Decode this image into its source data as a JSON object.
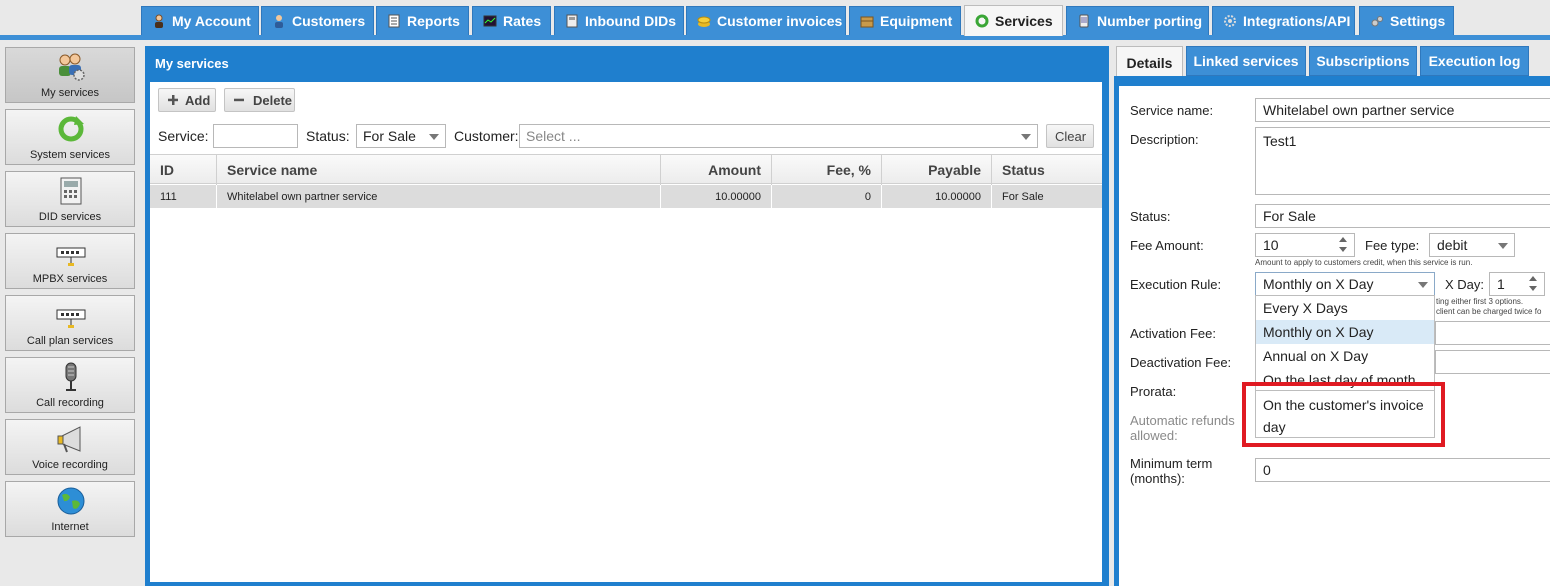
{
  "top_tabs": [
    {
      "label": "My Account",
      "icon": "user-icon"
    },
    {
      "label": "Customers",
      "icon": "customers-icon"
    },
    {
      "label": "Reports",
      "icon": "reports-icon"
    },
    {
      "label": "Rates",
      "icon": "rates-icon"
    },
    {
      "label": "Inbound DIDs",
      "icon": "dids-icon"
    },
    {
      "label": "Customer invoices",
      "icon": "coins-icon"
    },
    {
      "label": "Equipment",
      "icon": "box-icon"
    },
    {
      "label": "Services",
      "icon": "services-icon"
    },
    {
      "label": "Number porting",
      "icon": "phone-icon"
    },
    {
      "label": "Integrations/API",
      "icon": "gear-icon"
    },
    {
      "label": "Settings",
      "icon": "settings-icon"
    }
  ],
  "active_top_tab": "Services",
  "sidebar": {
    "items": [
      {
        "label": "My services",
        "icon": "users-gear-icon"
      },
      {
        "label": "System services",
        "icon": "refresh-icon"
      },
      {
        "label": "DID services",
        "icon": "desk-phone-icon"
      },
      {
        "label": "MPBX services",
        "icon": "switch-icon"
      },
      {
        "label": "Call plan services",
        "icon": "switch-icon"
      },
      {
        "label": "Call recording",
        "icon": "microphone-icon"
      },
      {
        "label": "Voice recording",
        "icon": "megaphone-icon"
      },
      {
        "label": "Internet",
        "icon": "globe-icon"
      }
    ]
  },
  "main": {
    "title": "My services",
    "add_label": "Add",
    "delete_label": "Delete",
    "filters": {
      "service_label": "Service:",
      "service_value": "",
      "status_label": "Status:",
      "status_value": "For Sale",
      "customer_label": "Customer:",
      "customer_placeholder": "Select ...",
      "clear_label": "Clear"
    },
    "columns": [
      "ID",
      "Service name",
      "Amount",
      "Fee, %",
      "Payable",
      "Status"
    ],
    "rows": [
      {
        "id": "111",
        "name": "Whitelabel own partner service",
        "amount": "10.00000",
        "fee": "0",
        "payable": "10.00000",
        "status": "For Sale"
      }
    ]
  },
  "detail": {
    "tabs": [
      "Details",
      "Linked services",
      "Subscriptions",
      "Execution log"
    ],
    "active_tab": "Details",
    "service_name_label": "Service name:",
    "service_name_value": "Whitelabel own partner service",
    "description_label": "Description:",
    "description_value": "Test1",
    "status_label": "Status:",
    "status_value": "For Sale",
    "fee_amount_label": "Fee Amount:",
    "fee_amount_value": "10",
    "fee_type_label": "Fee type:",
    "fee_type_value": "debit",
    "fee_hint": "Amount to apply to customers credit, when this service is run.",
    "execution_rule_label": "Execution Rule:",
    "execution_rule_value": "Monthly on X Day",
    "x_day_label": "X Day:",
    "x_day_value": "1",
    "rule_hint_1": "ting either first 3 options.",
    "rule_hint_2": "client can be charged twice fo",
    "activation_fee_label": "Activation Fee:",
    "deactivation_fee_label": "Deactivation Fee:",
    "prorata_label": "Prorata:",
    "auto_refunds_label_1": "Automatic refunds",
    "auto_refunds_label_2": "allowed:",
    "minimum_term_label_1": "Minimum term",
    "minimum_term_label_2": "(months):",
    "minimum_term_value": "0",
    "rule_options": [
      "Every X Days",
      "Monthly on X Day",
      "Annual on X Day",
      "On the last day of month",
      "On the customer's invoice day"
    ],
    "highlight_color": "#e01a22"
  }
}
